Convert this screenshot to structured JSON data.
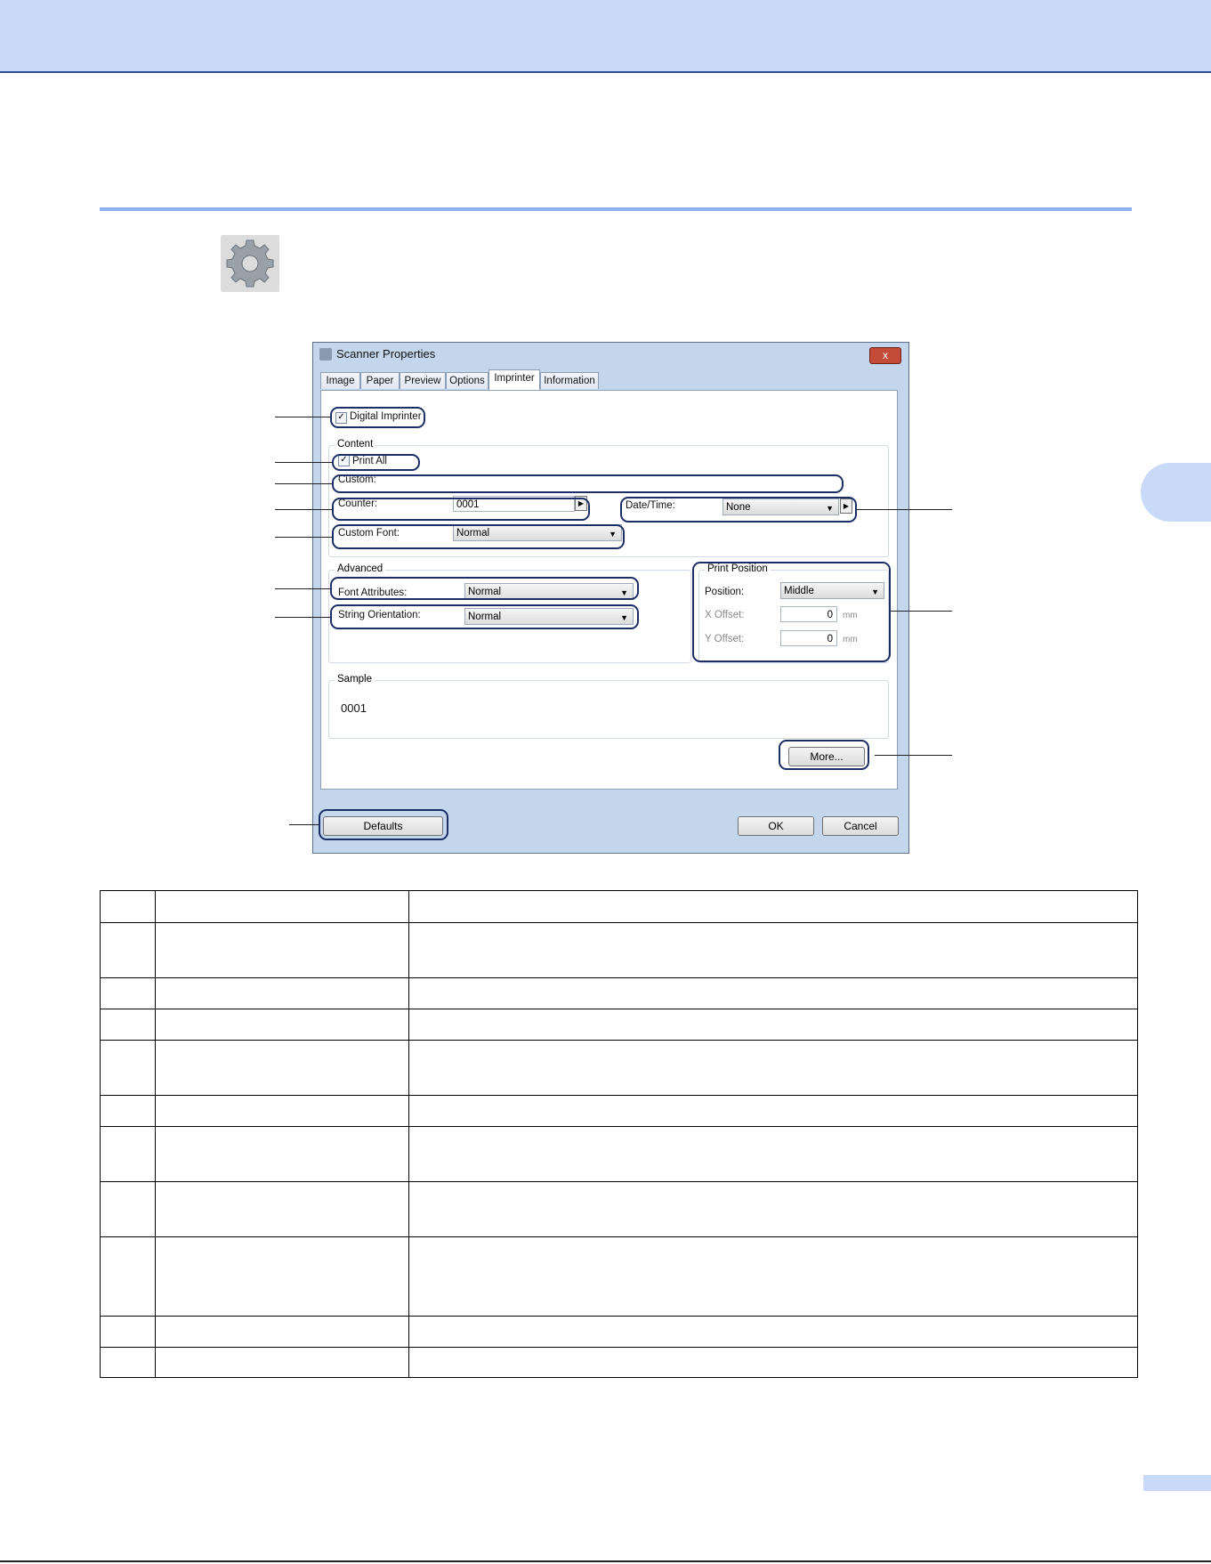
{
  "dialog": {
    "title": "Scanner Properties",
    "close_label": "x",
    "tabs": [
      {
        "label": "Image"
      },
      {
        "label": "Paper"
      },
      {
        "label": "Preview"
      },
      {
        "label": "Options"
      },
      {
        "label": "Imprinter",
        "active": true
      },
      {
        "label": "Information"
      }
    ],
    "digital_imprinter": {
      "label": "Digital Imprinter",
      "checked": true
    },
    "content": {
      "title": "Content",
      "print_all": {
        "label": "Print All",
        "checked": true
      },
      "custom": {
        "label": "Custom:",
        "value": ""
      },
      "counter": {
        "label": "Counter:",
        "value": "0001"
      },
      "date_time": {
        "label": "Date/Time:",
        "value": "None"
      },
      "custom_font": {
        "label": "Custom Font:",
        "value": "Normal"
      }
    },
    "advanced": {
      "title": "Advanced",
      "font_attributes": {
        "label": "Font Attributes:",
        "value": "Normal"
      },
      "string_orientation": {
        "label": "String Orientation:",
        "value": "Normal"
      }
    },
    "print_position": {
      "title": "Print Position",
      "position": {
        "label": "Position:",
        "value": "Middle"
      },
      "x_offset": {
        "label": "X Offset:",
        "value": "0",
        "unit": "mm"
      },
      "y_offset": {
        "label": "Y Offset:",
        "value": "0",
        "unit": "mm"
      }
    },
    "sample": {
      "title": "Sample",
      "value": "0001"
    },
    "buttons": {
      "more": "More...",
      "defaults": "Defaults",
      "ok": "OK",
      "cancel": "Cancel"
    }
  },
  "icons": {
    "settings": "gear-icon",
    "scanner": "scanner-icon"
  },
  "colors": {
    "header_band": "#c9daf8",
    "rule": "#8eaff0",
    "callout": "#1b2f66"
  }
}
